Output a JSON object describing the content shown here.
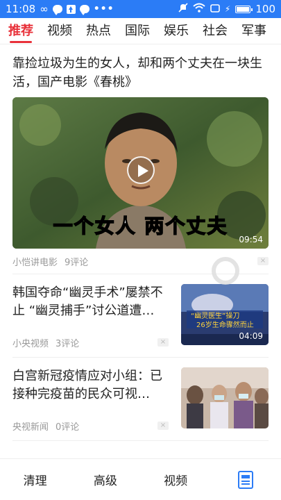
{
  "status_bar": {
    "time": "11:08",
    "battery": "100",
    "left_icons": [
      "infinity-icon",
      "message-icon",
      "upload-icon",
      "message-icon",
      "more-dots-icon"
    ],
    "right_icons": [
      "mute-icon",
      "wifi-icon",
      "screen-icon",
      "charging-icon",
      "battery-icon"
    ]
  },
  "tabs": [
    {
      "label": "推荐",
      "active": true
    },
    {
      "label": "视频",
      "active": false
    },
    {
      "label": "热点",
      "active": false
    },
    {
      "label": "国际",
      "active": false
    },
    {
      "label": "娱乐",
      "active": false
    },
    {
      "label": "社会",
      "active": false
    },
    {
      "label": "军事",
      "active": false
    }
  ],
  "feed": {
    "big_card": {
      "title": "靠捡垃圾为生的女人，却和两个丈夫在一块生活，国产电影《春桃》",
      "video_caption": "一个女人 两个丈夫",
      "duration": "09:54",
      "source": "小恺讲电影",
      "comments": "9评论"
    },
    "small_cards": [
      {
        "title": "韩国夺命“幽灵手术”屡禁不止 “幽灵捕手”讨公道遭…",
        "source": "小央视频",
        "comments": "3评论",
        "duration": "04:09",
        "thumb_caption_1": "“幽灵医生”操刀",
        "thumb_caption_2": "26岁生命骤然而止"
      },
      {
        "title": "白宫新冠疫情应对小组：已接种完疫苗的民众可视…",
        "source": "央视新闻",
        "comments": "0评论"
      }
    ]
  },
  "bottom_nav": {
    "items": [
      "清理",
      "高级",
      "视频"
    ],
    "icon": "news-doc-icon"
  },
  "colors": {
    "status_bar": "#2b7cf6",
    "accent_red": "#e8313a",
    "accent_blue": "#2b7cf6"
  }
}
